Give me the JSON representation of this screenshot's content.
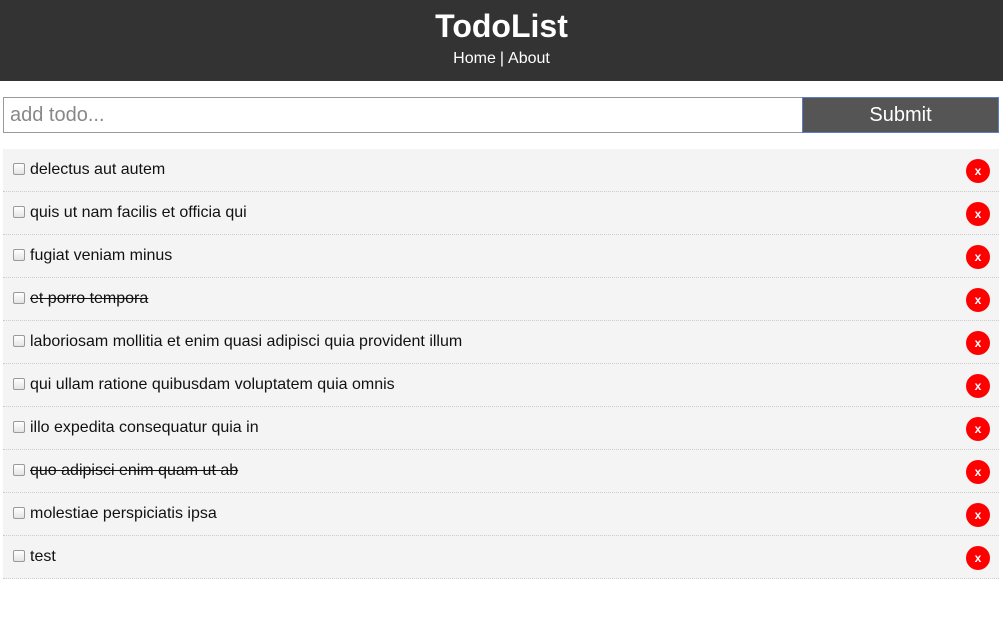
{
  "header": {
    "title": "TodoList",
    "nav": {
      "home": "Home",
      "separator": "|",
      "about": "About"
    }
  },
  "form": {
    "placeholder": "add todo...",
    "value": "",
    "submit_label": "Submit"
  },
  "todos": [
    {
      "title": "delectus aut autem",
      "completed": false,
      "delete_label": "x"
    },
    {
      "title": "quis ut nam facilis et officia qui",
      "completed": false,
      "delete_label": "x"
    },
    {
      "title": "fugiat veniam minus",
      "completed": false,
      "delete_label": "x"
    },
    {
      "title": "et porro tempora",
      "completed": true,
      "delete_label": "x"
    },
    {
      "title": "laboriosam mollitia et enim quasi adipisci quia provident illum",
      "completed": false,
      "delete_label": "x"
    },
    {
      "title": "qui ullam ratione quibusdam voluptatem quia omnis",
      "completed": false,
      "delete_label": "x"
    },
    {
      "title": "illo expedita consequatur quia in",
      "completed": false,
      "delete_label": "x"
    },
    {
      "title": "quo adipisci enim quam ut ab",
      "completed": true,
      "delete_label": "x"
    },
    {
      "title": "molestiae perspiciatis ipsa",
      "completed": false,
      "delete_label": "x"
    },
    {
      "title": "test",
      "completed": false,
      "delete_label": "x"
    }
  ],
  "colors": {
    "header_bg": "#333333",
    "submit_bg": "#555555",
    "delete_bg": "#ff0000",
    "item_bg": "#f4f4f4"
  }
}
